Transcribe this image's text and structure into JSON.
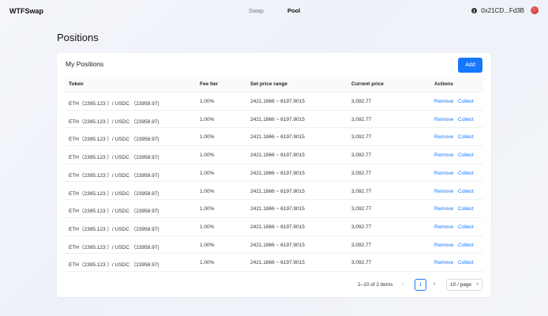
{
  "app": {
    "name": "WTFSwap"
  },
  "nav": {
    "items": [
      {
        "label": "Swap",
        "active": false
      },
      {
        "label": "Pool",
        "active": true
      }
    ]
  },
  "wallet": {
    "address": "0x21CD...Fd3B",
    "icon": "wallet-icon"
  },
  "page": {
    "title": "Positions"
  },
  "card": {
    "title": "My Positions",
    "add_label": "Add"
  },
  "table": {
    "headers": {
      "token": "Token",
      "fee_tier": "Fee tier",
      "price_range": "Set price range",
      "current_price": "Current price",
      "actions": "Actions"
    },
    "rows": [
      {
        "token": "ETH（2395.123 ）/ USDC （23958.97)",
        "fee": "1.00%",
        "range": "2421.1866 ~ 6197.9015",
        "price": "3,092.77",
        "remove": "Remove",
        "collect": "Collect"
      },
      {
        "token": "ETH（2395.123 ）/ USDC （23958.97)",
        "fee": "1.00%",
        "range": "2421.1866 ~ 6197.9015",
        "price": "3,092.77",
        "remove": "Remove",
        "collect": "Collect"
      },
      {
        "token": "ETH（2395.123 ）/ USDC （23958.97)",
        "fee": "1.00%",
        "range": "2421.1866 ~ 6197.9015",
        "price": "3,092.77",
        "remove": "Remove",
        "collect": "Collect"
      },
      {
        "token": "ETH（2395.123 ）/ USDC （23958.97)",
        "fee": "1.00%",
        "range": "2421.1866 ~ 6197.9015",
        "price": "3,092.77",
        "remove": "Remove",
        "collect": "Collect"
      },
      {
        "token": "ETH（2395.123 ）/ USDC （23958.97)",
        "fee": "1.00%",
        "range": "2421.1866 ~ 6197.9015",
        "price": "3,092.77",
        "remove": "Remove",
        "collect": "Collect"
      },
      {
        "token": "ETH（2395.123 ）/ USDC （23958.97)",
        "fee": "1.00%",
        "range": "2421.1866 ~ 6197.9015",
        "price": "3,092.77",
        "remove": "Remove",
        "collect": "Collect"
      },
      {
        "token": "ETH（2395.123 ）/ USDC （23958.97)",
        "fee": "1.00%",
        "range": "2421.1866 ~ 6197.9015",
        "price": "3,092.77",
        "remove": "Remove",
        "collect": "Collect"
      },
      {
        "token": "ETH（2395.123 ）/ USDC （23958.97)",
        "fee": "1.00%",
        "range": "2421.1866 ~ 6197.9015",
        "price": "3,092.77",
        "remove": "Remove",
        "collect": "Collect"
      },
      {
        "token": "ETH（2395.123 ）/ USDC （23958.97)",
        "fee": "1.00%",
        "range": "2421.1866 ~ 6197.9015",
        "price": "3,092.77",
        "remove": "Remove",
        "collect": "Collect"
      },
      {
        "token": "ETH（2395.123 ）/ USDC （23958.97)",
        "fee": "1.00%",
        "range": "2421.1866 ~ 6197.9015",
        "price": "3,092.77",
        "remove": "Remove",
        "collect": "Collect"
      }
    ]
  },
  "pagination": {
    "total": "1–10 of 2 items",
    "prev": "‹",
    "page": "1",
    "next": "›",
    "page_size": "10 / page"
  },
  "colors": {
    "accent": "#1677ff"
  }
}
